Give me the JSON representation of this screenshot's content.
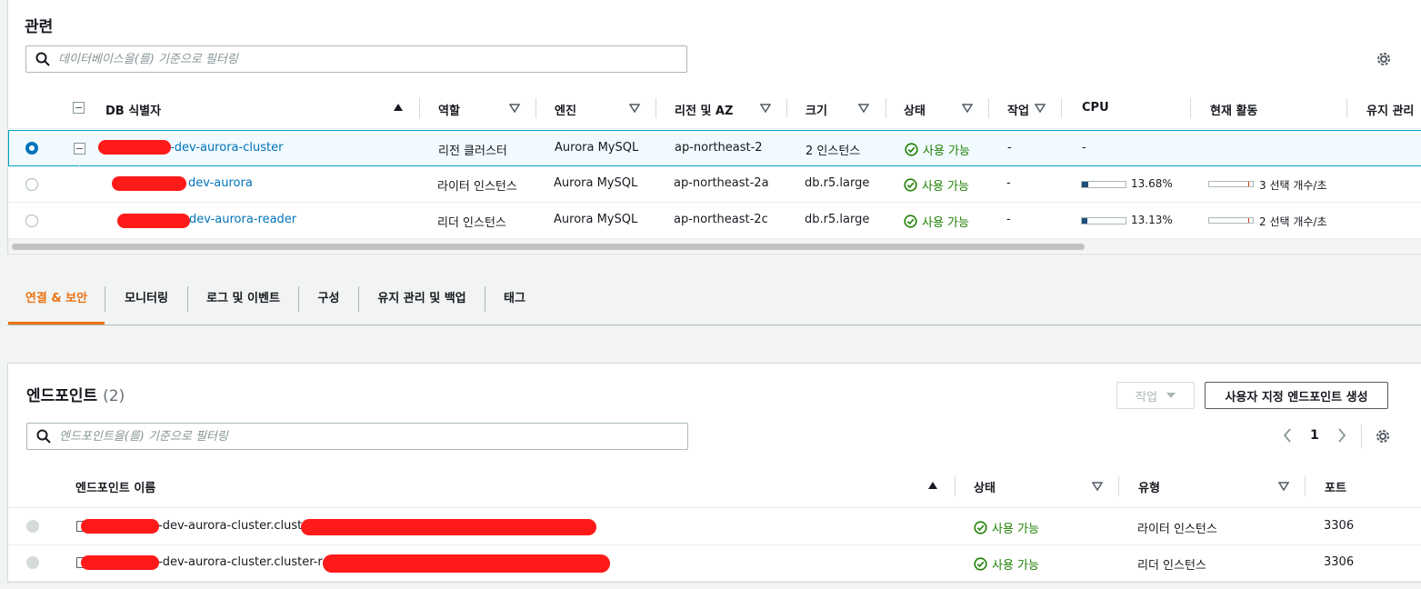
{
  "related": {
    "title": "관련",
    "search_placeholder": "데이터베이스을(를) 기준으로 필터링",
    "columns": {
      "id": "DB 식별자",
      "role": "역할",
      "engine": "엔진",
      "region": "리전 및 AZ",
      "size": "크기",
      "status": "상태",
      "action": "작업",
      "cpu": "CPU",
      "activity": "현재 활동",
      "maint": "유지 관리"
    },
    "rows": [
      {
        "id": "-dev-aurora-cluster",
        "role": "리전 클러스터",
        "engine": "Aurora MySQL",
        "region": "ap-northeast-2",
        "size": "2 인스턴스",
        "status": "사용 가능",
        "action": "-",
        "cpu": "-",
        "cpu_pct": null,
        "activity": ""
      },
      {
        "id": "dev-aurora",
        "role": "라이터 인스턴스",
        "engine": "Aurora MySQL",
        "region": "ap-northeast-2a",
        "size": "db.r5.large",
        "status": "사용 가능",
        "action": "-",
        "cpu": "13.68%",
        "cpu_pct": 13.68,
        "activity": "3 선택 개수/초"
      },
      {
        "id": "dev-aurora-reader",
        "role": "리더 인스턴스",
        "engine": "Aurora MySQL",
        "region": "ap-northeast-2c",
        "size": "db.r5.large",
        "status": "사용 가능",
        "action": "-",
        "cpu": "13.13%",
        "cpu_pct": 13.13,
        "activity": "2 선택 개수/초"
      }
    ]
  },
  "tabs": [
    "연결 & 보안",
    "모니터링",
    "로그 및 이벤트",
    "구성",
    "유지 관리 및 백업",
    "태그"
  ],
  "active_tab": "연결 & 보안",
  "endpoints": {
    "title": "엔드포인트",
    "count": "(2)",
    "actions_label": "작업",
    "create_label": "사용자 지정 엔드포인트 생성",
    "search_placeholder": "엔드포인트을(를) 기준으로 필터링",
    "page": "1",
    "columns": {
      "name": "엔드포인트 이름",
      "status": "상태",
      "type": "유형",
      "port": "포트"
    },
    "rows": [
      {
        "name": "-dev-aurora-cluster.cluste",
        "status": "사용 가능",
        "type": "라이터 인스턴스",
        "port": "3306"
      },
      {
        "name": "-dev-aurora-cluster.cluster-ro",
        "status": "사용 가능",
        "type": "리더 인스턴스",
        "port": "3306"
      }
    ]
  },
  "colors": {
    "accent": "#ec7211",
    "link": "#0073bb",
    "success": "#1d8102",
    "redaction": "#ff1a1a"
  }
}
